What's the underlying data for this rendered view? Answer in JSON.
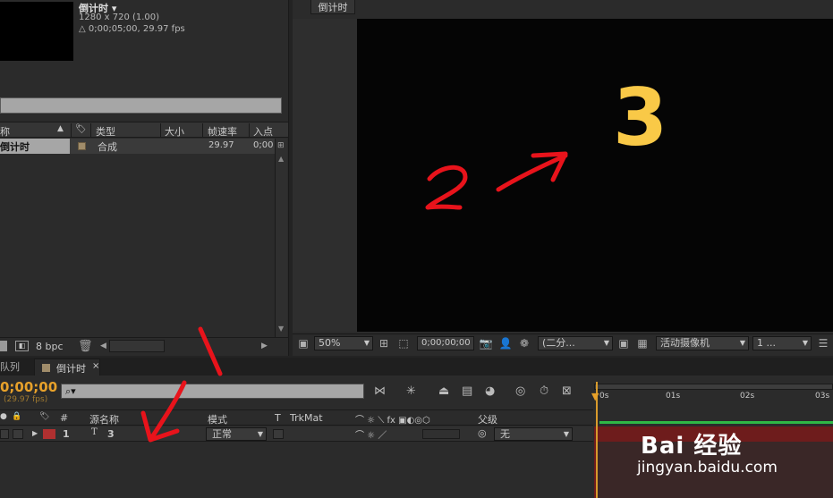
{
  "project": {
    "comp_name": "倒计时 ▾",
    "resolution": "1280 x 720 (1.00)",
    "duration": "△ 0;00;05;00, 29.97 fps",
    "columns": [
      "称",
      "类型",
      "大小",
      "帧速率",
      "入点"
    ],
    "item": {
      "name": "倒计时",
      "type": "合成",
      "fps": "29.97",
      "in": "0;00"
    },
    "bit_depth": "8 bpc"
  },
  "viewer": {
    "tab_label": "倒计时",
    "canvas_text": "3",
    "zoom": "50%",
    "timecode": "0;00;00;00",
    "resolution": "(二分...",
    "camera": "活动摄像机",
    "views": "1 ..."
  },
  "timeline": {
    "queue_tab": "队列",
    "comp_tab": "倒计时",
    "timecode": "0;00;00",
    "fps": "(29.97 fps)",
    "search_icon": "⌕▾",
    "headers": {
      "num": "#",
      "source": "源名称",
      "mode": "模式",
      "t": "T",
      "trkmat": "TrkMat",
      "parent": "父级"
    },
    "layer": {
      "num": "1",
      "name": "3",
      "mode": "正常",
      "parent": "无"
    },
    "ruler_ticks": [
      "0s",
      "01s",
      "02s",
      "03s"
    ]
  },
  "annotations": {
    "one": "1",
    "two": "2"
  },
  "watermark": {
    "brand": "Bai  经验",
    "url": "jingyan.baidu.com"
  },
  "colors": {
    "accent_timecode": "#e7a12a",
    "canvas_text": "#f9c947",
    "annotation": "#e8131b"
  }
}
